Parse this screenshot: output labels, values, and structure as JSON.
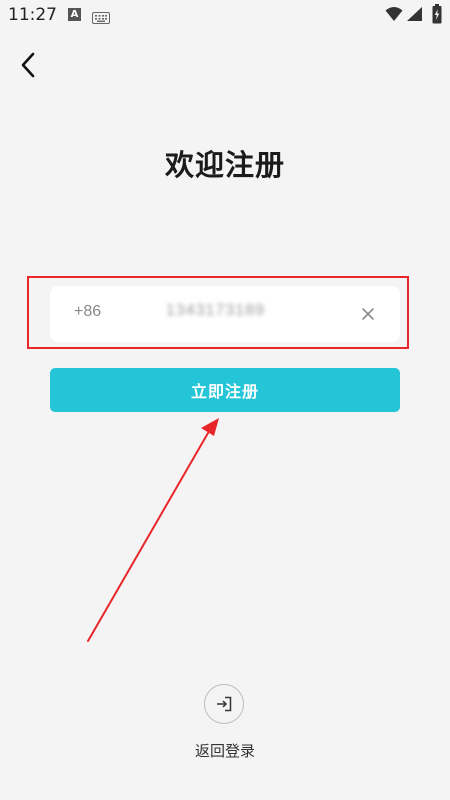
{
  "status_bar": {
    "time": "11:27",
    "notification_letter": "A",
    "icons": [
      "a-notification-icon",
      "keyboard-icon",
      "wifi-icon",
      "signal-icon",
      "battery-charging-icon"
    ]
  },
  "header": {
    "back_icon": "chevron-left-icon",
    "title": "欢迎注册"
  },
  "form": {
    "country_code": "+86",
    "phone_value": "1343173189",
    "clear_icon": "close-icon",
    "register_label": "立即注册"
  },
  "footer": {
    "login_icon": "login-icon",
    "back_login_label": "返回登录"
  },
  "colors": {
    "background": "#f4f4f4",
    "accent": "#25c5d8",
    "annotation": "#e8262a"
  }
}
